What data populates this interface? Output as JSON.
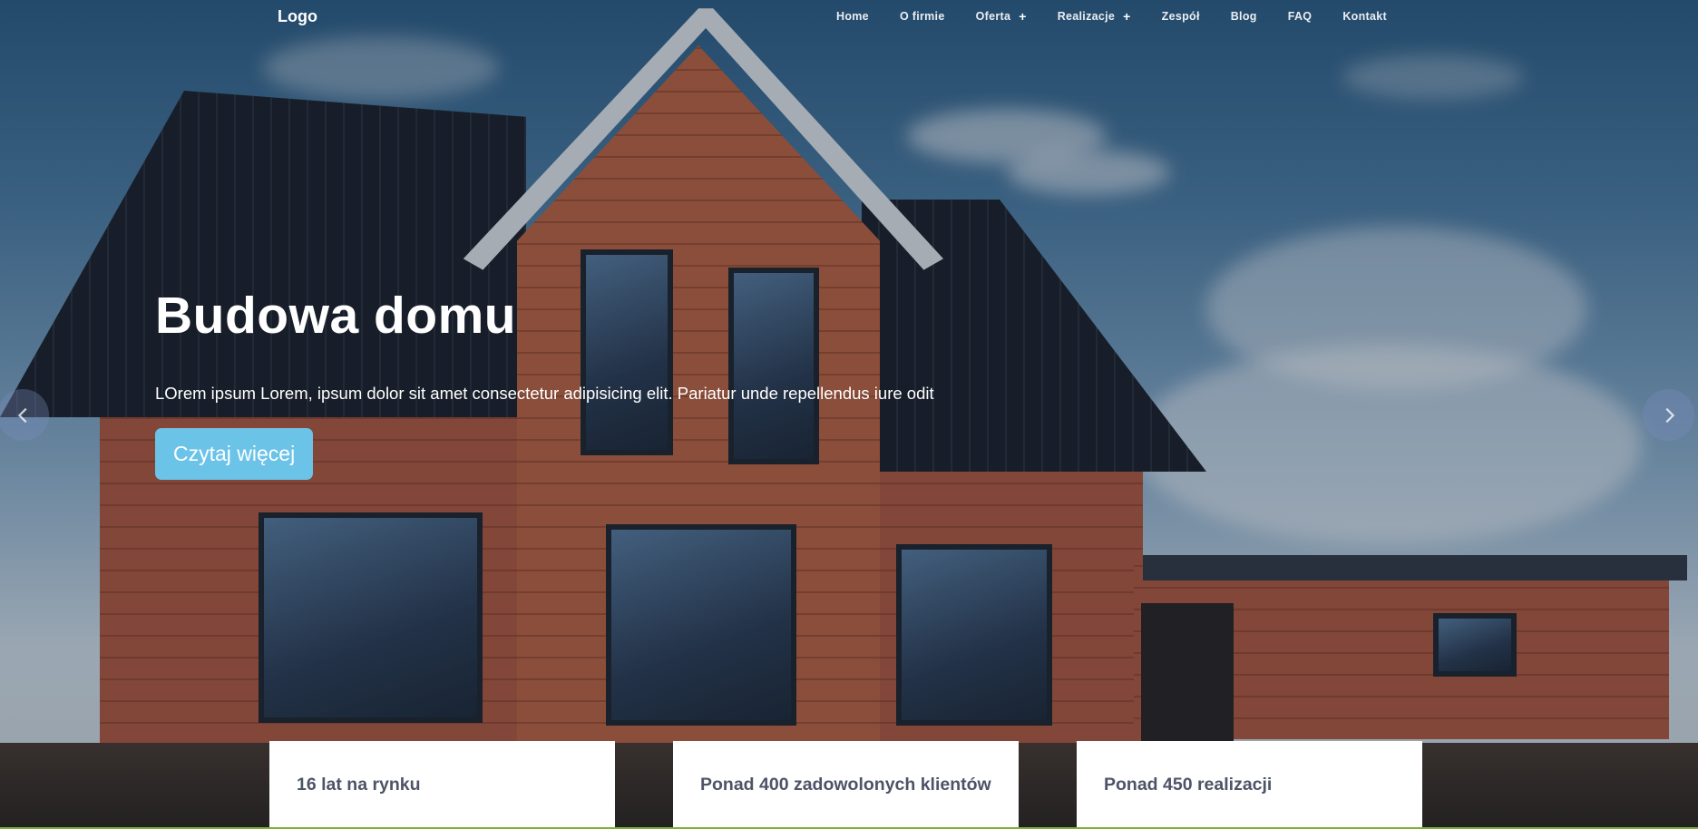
{
  "nav": {
    "logo": "Logo",
    "items": [
      {
        "label": "Home",
        "has_submenu": false
      },
      {
        "label": "O firmie",
        "has_submenu": false
      },
      {
        "label": "Oferta",
        "has_submenu": true
      },
      {
        "label": "Realizacje",
        "has_submenu": true
      },
      {
        "label": "Zespół",
        "has_submenu": false
      },
      {
        "label": "Blog",
        "has_submenu": false
      },
      {
        "label": "FAQ",
        "has_submenu": false
      },
      {
        "label": "Kontakt",
        "has_submenu": false
      }
    ],
    "submenu_icon": "+"
  },
  "hero": {
    "title": "Budowa domu",
    "text": "LOrem ipsum Lorem, ipsum dolor sit amet consectetur adipisicing elit. Pariatur unde repellendus iure odit",
    "button_label": "Czytaj więcej",
    "accent_color": "#6cc3e8"
  },
  "carousel": {
    "prev_icon": "chevron-left-icon",
    "next_icon": "chevron-right-icon"
  },
  "stats": [
    {
      "text": "16 lat na rynku"
    },
    {
      "text": "Ponad 400 zadowolonych klientów"
    },
    {
      "text": "Ponad 450 realizacji"
    }
  ]
}
